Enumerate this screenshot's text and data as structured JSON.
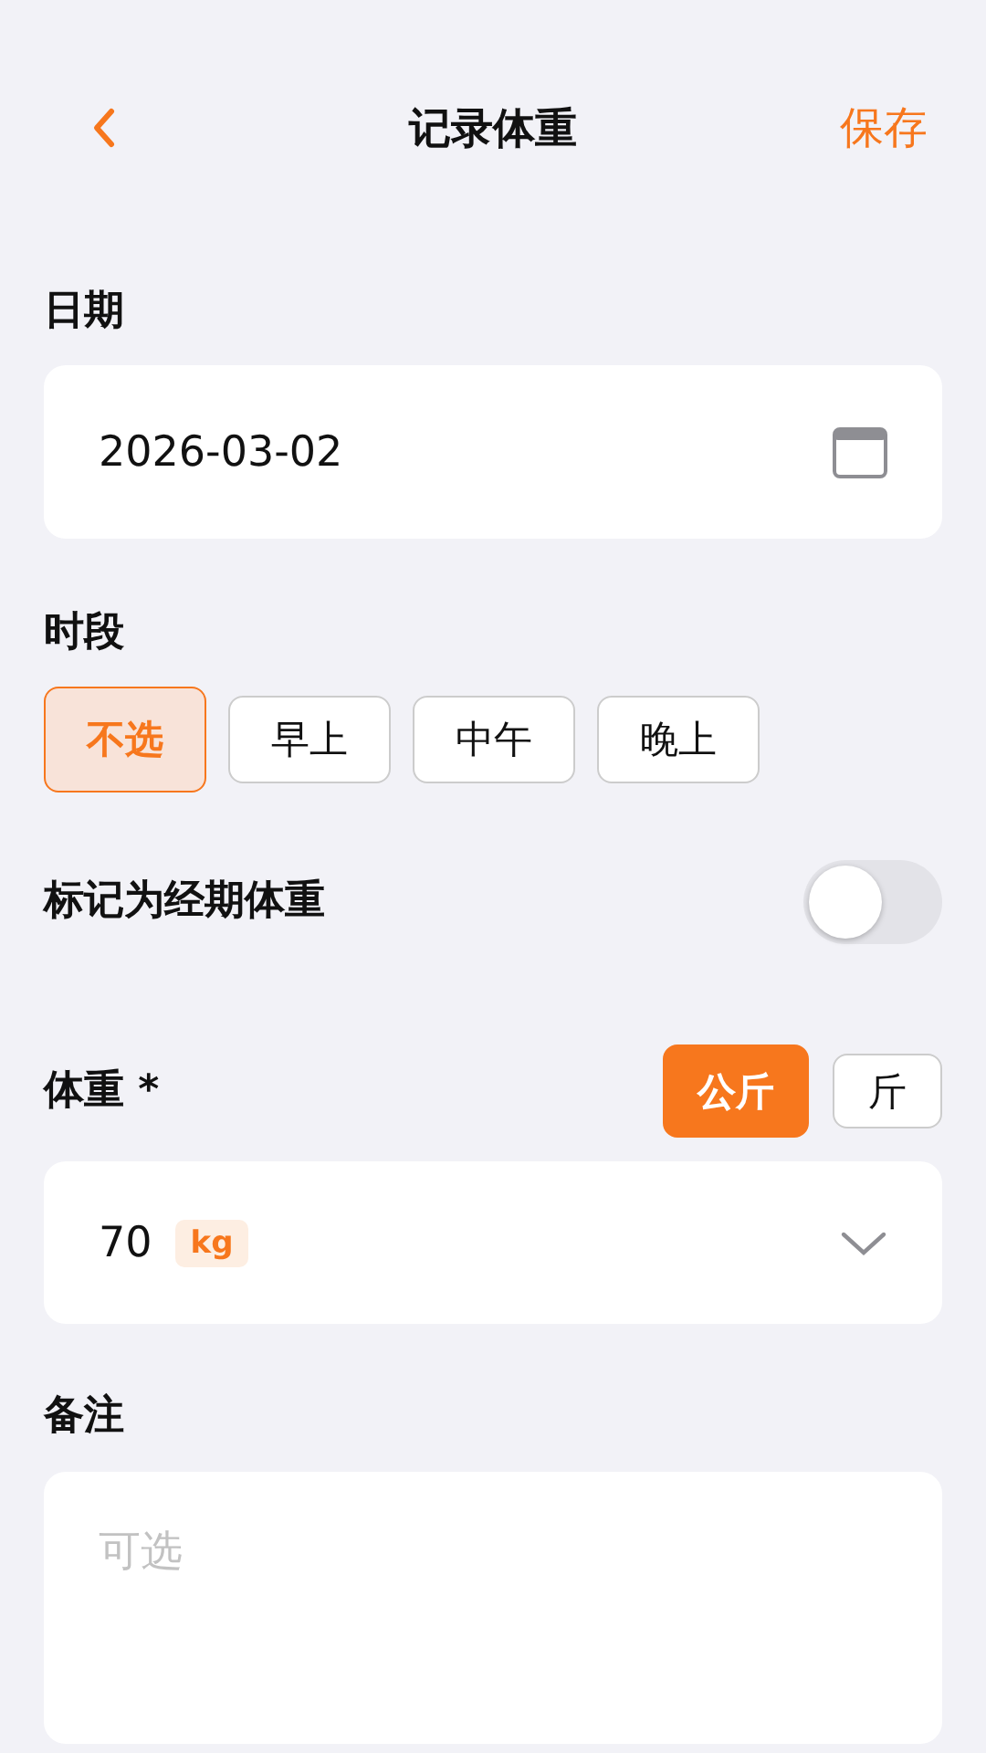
{
  "header": {
    "title": "记录体重",
    "save": "保存"
  },
  "date": {
    "label": "日期",
    "value": "2026-03-02"
  },
  "period": {
    "label": "时段",
    "options": [
      {
        "label": "不选",
        "selected": true
      },
      {
        "label": "早上",
        "selected": false
      },
      {
        "label": "中午",
        "selected": false
      },
      {
        "label": "晚上",
        "selected": false
      }
    ]
  },
  "period_weight": {
    "label": "标记为经期体重",
    "on": false
  },
  "weight": {
    "label": "体重 *",
    "units": [
      {
        "label": "公斤",
        "selected": true
      },
      {
        "label": "斤",
        "selected": false
      }
    ],
    "value": "70",
    "unit_badge": "kg"
  },
  "note": {
    "label": "备注",
    "placeholder": "可选"
  }
}
